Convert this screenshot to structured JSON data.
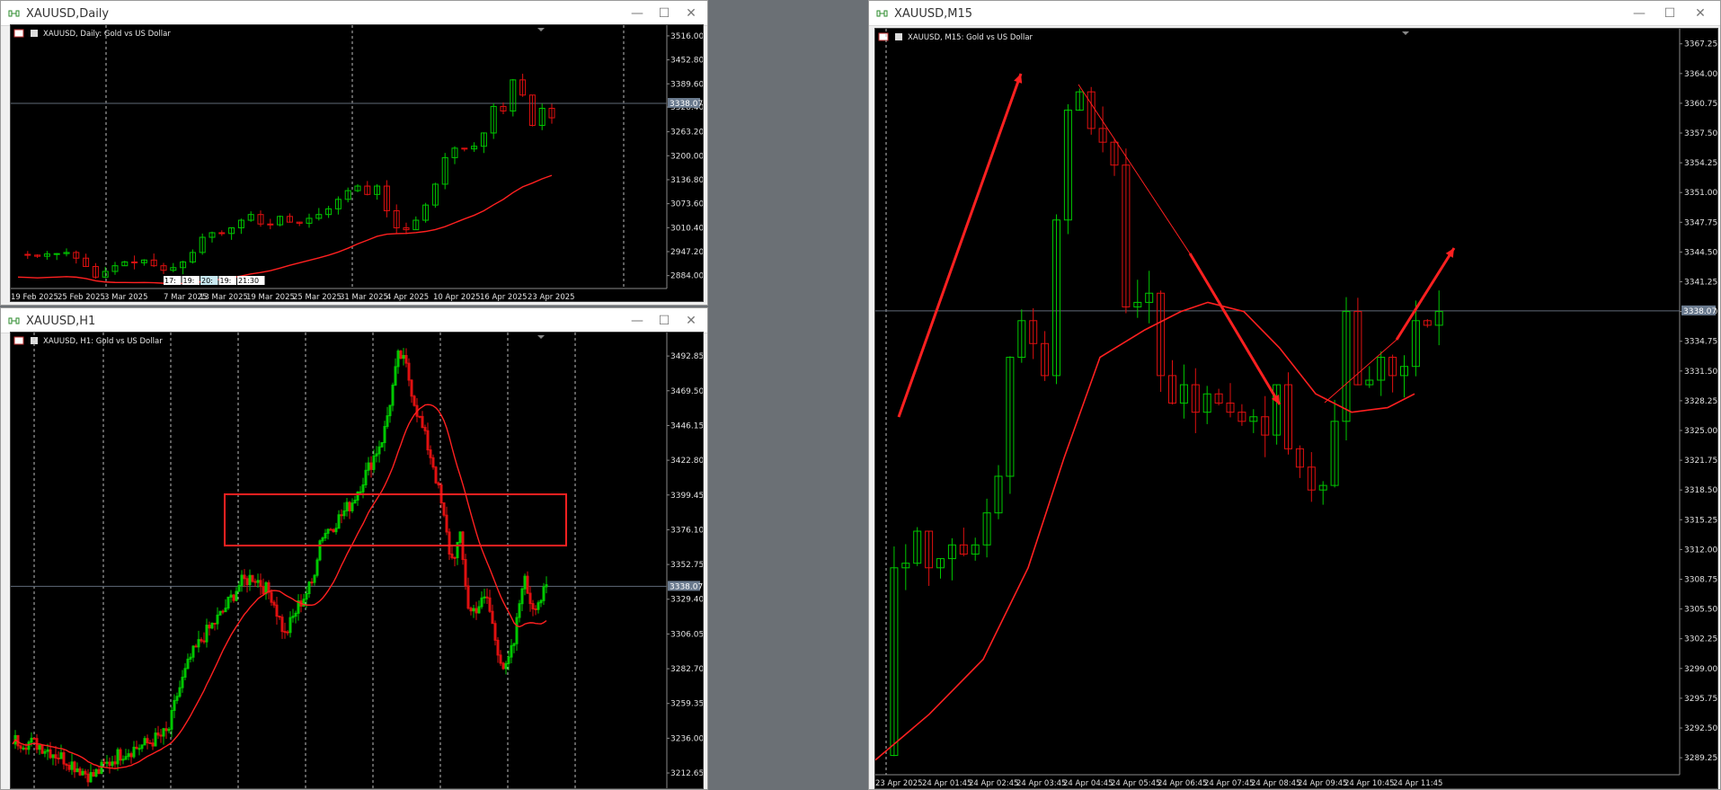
{
  "windows": {
    "daily": {
      "title": "XAUUSD,Daily",
      "label": "XAUUSD, Daily:  Gold vs US Dollar",
      "yticks": [
        "3516.00",
        "3452.80",
        "3389.60",
        "3328.40",
        "3263.20",
        "3200.00",
        "3136.80",
        "3073.60",
        "3010.40",
        "2947.20",
        "2884.00"
      ],
      "price_tag": "3338.07",
      "xticks": [
        "19 Feb 2025",
        "25 Feb 2025",
        "3 Mar 2025",
        "7 Mar 2025",
        "13 Mar 2025",
        "19 Mar 2025",
        "25 Mar 2025",
        "31 Mar 2025",
        "4 Apr 2025",
        "10 Apr 2025",
        "16 Apr 2025",
        "23 Apr 2025"
      ],
      "time_tags": [
        "17:",
        "19:",
        "20:",
        "19:",
        "21:30"
      ]
    },
    "h1": {
      "title": "XAUUSD,H1",
      "label": "XAUUSD, H1:  Gold vs US Dollar",
      "yticks": [
        "3492.85",
        "3469.50",
        "3446.15",
        "3422.80",
        "3399.45",
        "3376.10",
        "3352.75",
        "3329.40",
        "3306.05",
        "3282.70",
        "3259.35",
        "3236.00",
        "3212.65"
      ],
      "price_tag": "3338.07"
    },
    "m15": {
      "title": "XAUUSD,M15",
      "label": "XAUUSD, M15:  Gold vs US Dollar",
      "yticks": [
        "3367.25",
        "3364.00",
        "3360.75",
        "3357.50",
        "3354.25",
        "3351.00",
        "3347.75",
        "3344.50",
        "3341.25",
        "3338.00",
        "3334.75",
        "3331.50",
        "3328.25",
        "3325.00",
        "3321.75",
        "3318.50",
        "3315.25",
        "3312.00",
        "3308.75",
        "3305.50",
        "3302.25",
        "3299.00",
        "3295.75",
        "3292.50",
        "3289.25"
      ],
      "price_tag": "3338.07",
      "xticks": [
        "23 Apr 2025",
        "24 Apr 01:45",
        "24 Apr 02:45",
        "24 Apr 03:45",
        "24 Apr 04:45",
        "24 Apr 05:45",
        "24 Apr 06:45",
        "24 Apr 07:45",
        "24 Apr 08:45",
        "24 Apr 09:45",
        "24 Apr 10:45",
        "24 Apr 11:45"
      ]
    }
  },
  "colors": {
    "bull": "#00c800",
    "bear": "#e01010",
    "ma": "#ff2020",
    "grid": "#bdbdbd",
    "bg": "#000000",
    "axis_text": "#e0e0e0",
    "price_line": "#5f6a78",
    "annotation": "#ff2020"
  },
  "window_controls": {
    "minimize": "—",
    "maximize": "☐",
    "close": "✕"
  }
}
